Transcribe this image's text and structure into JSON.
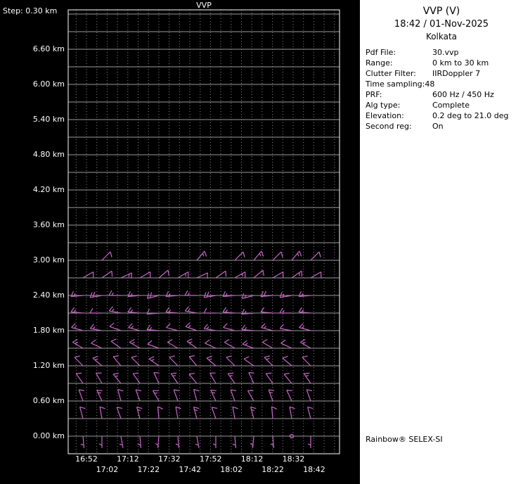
{
  "chart_data": {
    "type": "wind-barb-profile",
    "title": "VVP",
    "step_label": "Step: 0.30 km",
    "y_step_km": 0.3,
    "y_axis_unit": "km",
    "x_axis_unit": "time",
    "colors": {
      "background": "#000000",
      "frame": "#ffffff",
      "grid_h": "#9a9a9a",
      "grid_v": "#8a8a8a",
      "barb": "#cc66cc",
      "text": "#ffffff"
    },
    "y_tick_labels": [
      {
        "label": "6.60 km",
        "h_km": 6.6
      },
      {
        "label": "6.00 km",
        "h_km": 6.0
      },
      {
        "label": "5.40 km",
        "h_km": 5.4
      },
      {
        "label": "4.80 km",
        "h_km": 4.8
      },
      {
        "label": "4.20 km",
        "h_km": 4.2
      },
      {
        "label": "3.60 km",
        "h_km": 3.6
      },
      {
        "label": "3.00 km",
        "h_km": 3.0
      },
      {
        "label": "2.40 km",
        "h_km": 2.4
      },
      {
        "label": "1.80 km",
        "h_km": 1.8
      },
      {
        "label": "1.20 km",
        "h_km": 1.2
      },
      {
        "label": "0.60 km",
        "h_km": 0.6
      },
      {
        "label": "0.00 km",
        "h_km": 0.0
      }
    ],
    "x_tick_labels": [
      "16:52",
      "17:02",
      "17:12",
      "17:22",
      "17:32",
      "17:42",
      "17:52",
      "18:02",
      "18:12",
      "18:22",
      "18:32",
      "18:42"
    ],
    "levels": [
      {
        "h_km": 0.0,
        "dir_deg": [
          175,
          180,
          170,
          175,
          185,
          175,
          170,
          180,
          175,
          185,
          175,
          0,
          180
        ],
        "spd_kt": [
          5,
          5,
          7,
          5,
          7,
          5,
          5,
          7,
          5,
          5,
          7,
          0,
          5
        ]
      },
      {
        "h_km": 0.3,
        "dir_deg": [
          345,
          350,
          340,
          345,
          355,
          350,
          345,
          340,
          350,
          345,
          355,
          350,
          345
        ],
        "spd_kt": [
          10,
          10,
          10,
          15,
          10,
          10,
          15,
          10,
          10,
          15,
          10,
          10,
          10
        ]
      },
      {
        "h_km": 0.6,
        "dir_deg": [
          340,
          335,
          345,
          340,
          330,
          340,
          345,
          335,
          340,
          330,
          340,
          335,
          340
        ],
        "spd_kt": [
          10,
          15,
          10,
          10,
          15,
          10,
          10,
          15,
          10,
          10,
          15,
          10,
          10
        ]
      },
      {
        "h_km": 0.9,
        "dir_deg": [
          325,
          330,
          320,
          325,
          335,
          325,
          320,
          330,
          325,
          335,
          325,
          320,
          325
        ],
        "spd_kt": [
          10,
          10,
          15,
          10,
          10,
          15,
          10,
          10,
          15,
          10,
          10,
          10,
          15
        ]
      },
      {
        "h_km": 1.2,
        "dir_deg": [
          315,
          310,
          320,
          315,
          305,
          315,
          320,
          310,
          315,
          305,
          315,
          310,
          315
        ],
        "spd_kt": [
          10,
          15,
          10,
          10,
          15,
          10,
          10,
          15,
          10,
          10,
          15,
          10,
          10
        ]
      },
      {
        "h_km": 1.5,
        "dir_deg": [
          300,
          295,
          305,
          300,
          290,
          300,
          305,
          295,
          300,
          290,
          300,
          295,
          300
        ],
        "spd_kt": [
          15,
          10,
          10,
          15,
          10,
          10,
          15,
          10,
          10,
          15,
          10,
          10,
          15
        ]
      },
      {
        "h_km": 1.8,
        "dir_deg": [
          285,
          280,
          290,
          285,
          275,
          285,
          290,
          280,
          285,
          275,
          285,
          280,
          285
        ],
        "spd_kt": [
          15,
          15,
          10,
          15,
          15,
          10,
          15,
          15,
          10,
          15,
          15,
          10,
          15
        ]
      },
      {
        "h_km": 2.1,
        "dir_deg": [
          275,
          270,
          280,
          275,
          265,
          275,
          280,
          270,
          275,
          265,
          275,
          270,
          275
        ],
        "spd_kt": [
          15,
          10,
          15,
          15,
          10,
          15,
          15,
          10,
          15,
          15,
          10,
          15,
          15
        ]
      },
      {
        "h_km": 2.4,
        "dir_deg": [
          265,
          260,
          270,
          265,
          255,
          265,
          270,
          260,
          265,
          255,
          265,
          260,
          265
        ],
        "spd_kt": [
          15,
          20,
          15,
          15,
          20,
          15,
          15,
          20,
          15,
          15,
          20,
          15,
          15
        ]
      },
      {
        "h_km": 2.7,
        "dir_deg": [
          60,
          55,
          65,
          60,
          50,
          60,
          65,
          55,
          60,
          50,
          60,
          55,
          60
        ],
        "spd_kt": [
          10,
          10,
          15,
          10,
          10,
          15,
          10,
          10,
          15,
          10,
          10,
          15,
          10
        ]
      },
      {
        "h_km": 3.0,
        "dir_deg": [
          null,
          45,
          null,
          null,
          null,
          null,
          40,
          null,
          45,
          40,
          45,
          40,
          45
        ],
        "spd_kt": [
          null,
          10,
          null,
          null,
          null,
          null,
          15,
          null,
          10,
          15,
          10,
          15,
          10
        ]
      }
    ]
  },
  "info_panel": {
    "title": "VVP (V)",
    "datetime": "18:42 / 01-Nov-2025",
    "site": "Kolkata",
    "fields": [
      {
        "label": "Pdf File:",
        "value": "30.vvp",
        "tight": false
      },
      {
        "label": "Range:",
        "value": "0 km to 30 km",
        "tight": false
      },
      {
        "label": "Clutter Filter:",
        "value": "IIRDoppler 7",
        "tight": false
      },
      {
        "label": "Time sampling:",
        "value": "48",
        "tight": true
      },
      {
        "label": "PRF:",
        "value": "600 Hz / 450 Hz",
        "tight": false
      },
      {
        "label": "Alg type:",
        "value": "Complete",
        "tight": false
      },
      {
        "label": "Elevation:",
        "value": "0.2 deg to 21.0 deg",
        "tight": false
      },
      {
        "label": "Second reg:",
        "value": "On",
        "tight": false
      }
    ],
    "footer": "Rainbow® SELEX-SI"
  }
}
